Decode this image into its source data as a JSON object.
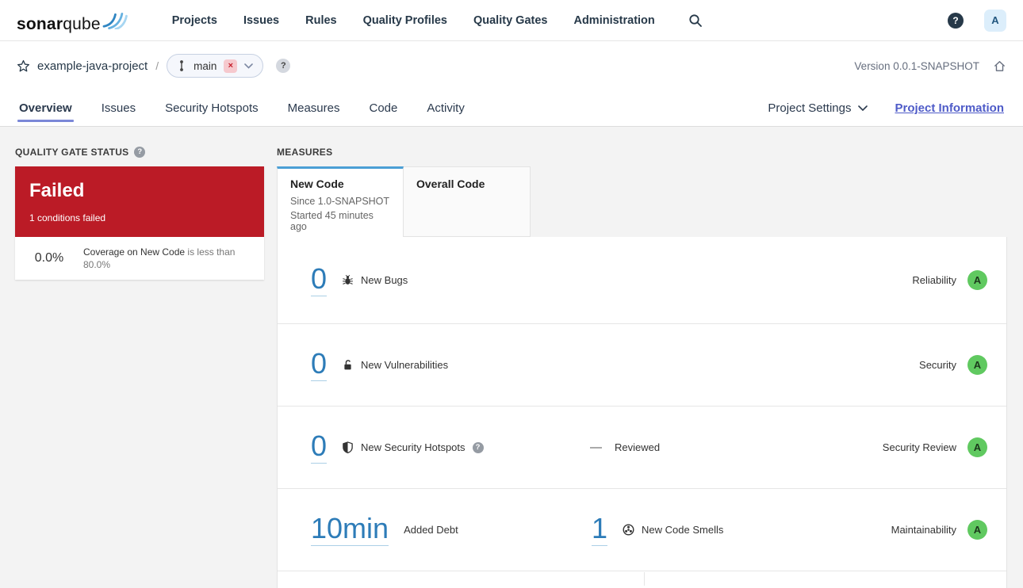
{
  "nav": {
    "logo_bold": "sonar",
    "logo_light": "qube",
    "items": [
      "Projects",
      "Issues",
      "Rules",
      "Quality Profiles",
      "Quality Gates",
      "Administration"
    ],
    "help_glyph": "?",
    "avatar_letter": "A"
  },
  "breadcrumb": {
    "project_name": "example-java-project",
    "separator": "/",
    "branch_name": "main",
    "branch_close_glyph": "×",
    "help_glyph": "?",
    "version_label": "Version 0.0.1-SNAPSHOT"
  },
  "tabs": {
    "items": [
      "Overview",
      "Issues",
      "Security Hotspots",
      "Measures",
      "Code",
      "Activity"
    ],
    "active_tab": "Overview",
    "project_settings_label": "Project Settings",
    "project_information_label": "Project Information"
  },
  "quality_gate": {
    "section_title": "QUALITY GATE STATUS",
    "help_glyph": "?",
    "status_label": "Failed",
    "conditions_summary": "1 conditions failed",
    "condition_value": "0.0%",
    "condition_metric": "Coverage on New Code",
    "condition_rule": "is less than 80.0%"
  },
  "measures": {
    "section_title": "MEASURES",
    "new_code_tab": {
      "label": "New Code",
      "since": "Since 1.0-SNAPSHOT",
      "started": "Started 45 minutes ago"
    },
    "overall_code_tab": {
      "label": "Overall Code"
    },
    "rows": [
      {
        "value": "0",
        "label": "New Bugs",
        "category": "Reliability",
        "rating": "A"
      },
      {
        "value": "0",
        "label": "New Vulnerabilities",
        "category": "Security",
        "rating": "A"
      },
      {
        "value": "0",
        "label": "New Security Hotspots",
        "help_glyph": "?",
        "reviewed_dash": "—",
        "reviewed_label": "Reviewed",
        "category": "Security Review",
        "rating": "A"
      },
      {
        "debt_value": "10min",
        "debt_label": "Added Debt",
        "smells_value": "1",
        "smells_label": "New Code Smells",
        "category": "Maintainability",
        "rating": "A"
      }
    ]
  },
  "colors": {
    "failed_red": "#bb1b26",
    "rating_a_green": "#60c960",
    "number_link_blue": "#2d7cb8",
    "active_tab_blue": "#4b9fd5",
    "overview_underline": "#7b88d8",
    "project_information_link": "#4e5bc8"
  }
}
